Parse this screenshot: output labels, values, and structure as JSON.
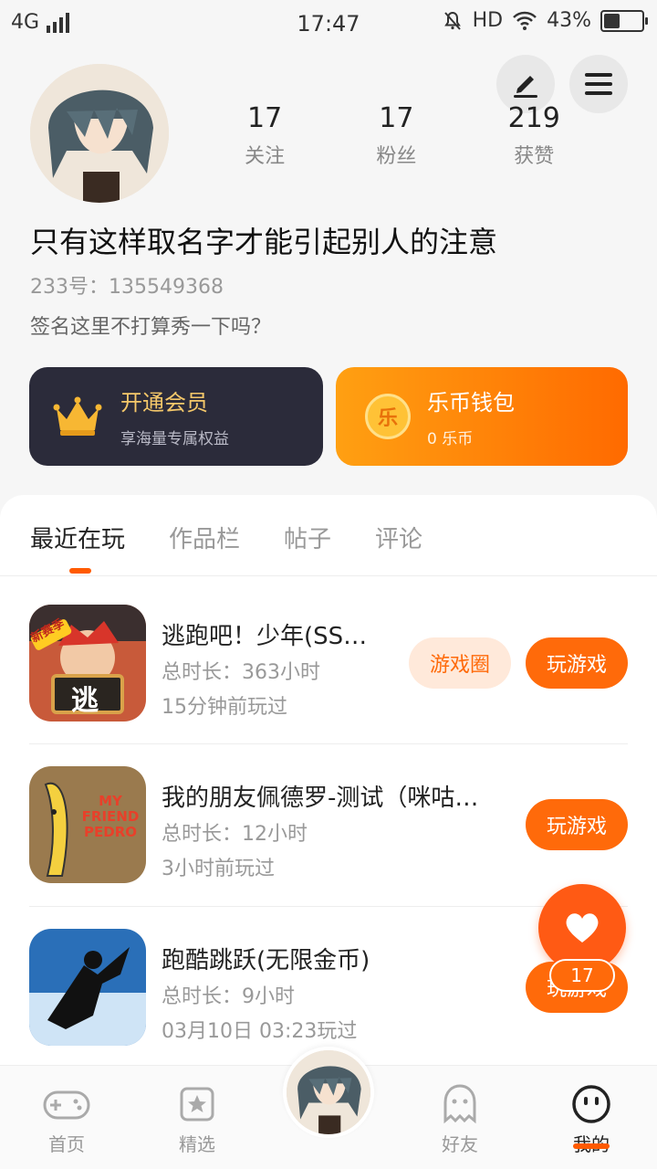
{
  "status_bar": {
    "network": "4G",
    "time": "17:47",
    "hd": "HD",
    "battery": "43%",
    "battery_level": 0.43
  },
  "profile": {
    "username": "只有这样取名字才能引起别人的注意",
    "uid": "233号：135549368",
    "signature": "签名这里不打算秀一下吗？",
    "stats": [
      {
        "value": "17",
        "label": "关注"
      },
      {
        "value": "17",
        "label": "粉丝"
      },
      {
        "value": "219",
        "label": "获赞"
      }
    ]
  },
  "cards": {
    "vip": {
      "title": "开通会员",
      "subtitle": "享海量专属权益"
    },
    "wallet": {
      "badge": "乐",
      "title": "乐币钱包",
      "subtitle": "0 乐币"
    }
  },
  "tabs": [
    {
      "label": "最近在玩",
      "active": true
    },
    {
      "label": "作品栏",
      "active": false
    },
    {
      "label": "帖子",
      "active": false
    },
    {
      "label": "评论",
      "active": false
    }
  ],
  "games": [
    {
      "icon": "game-icon-escape",
      "icon_text": "逃",
      "icon_badge": "新赛季",
      "title": "逃跑吧！少年(SS…",
      "duration": "总时长：363小时",
      "last_played": "15分钟前玩过",
      "circle_label": "游戏圈",
      "play_label": "玩游戏"
    },
    {
      "icon": "game-icon-pedro",
      "icon_text": "MY FRIEND PEDRO",
      "title": "我的朋友佩德罗-测试（咪咕…",
      "duration": "总时长：12小时",
      "last_played": "3小时前玩过",
      "play_label": "玩游戏"
    },
    {
      "icon": "game-icon-parkour",
      "title": "跑酷跳跃(无限金币)",
      "duration": "总时长：9小时",
      "last_played": "03月10日 03:23玩过",
      "play_label": "玩游戏"
    }
  ],
  "like_fab": {
    "count": "17"
  },
  "bottom_nav": [
    {
      "label": "首页",
      "icon": "gamepad-icon",
      "active": false
    },
    {
      "label": "精选",
      "icon": "star-icon",
      "active": false
    },
    {
      "label": "",
      "icon": "avatar",
      "active": false
    },
    {
      "label": "好友",
      "icon": "ghost-icon",
      "active": false
    },
    {
      "label": "我的",
      "icon": "smiley-icon",
      "active": true
    }
  ],
  "colors": {
    "accent": "#ff6a0a",
    "vip_bg": "#2b2b3a",
    "vip_text": "#f5c86a"
  }
}
